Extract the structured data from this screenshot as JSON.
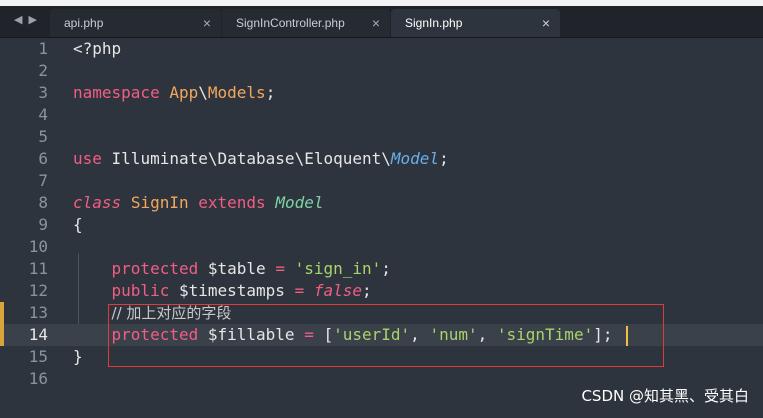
{
  "tabs": [
    {
      "label": "api.php",
      "close": "×",
      "active": false
    },
    {
      "label": "SignInController.php",
      "close": "×",
      "active": false
    },
    {
      "label": "SignIn.php",
      "close": "×",
      "active": true
    }
  ],
  "nav": {
    "prev": "◀",
    "next": "▶"
  },
  "lines": [
    {
      "n": "1",
      "tokens": [
        {
          "t": "<?php",
          "c": "plain"
        }
      ]
    },
    {
      "n": "2",
      "tokens": []
    },
    {
      "n": "3",
      "tokens": [
        {
          "t": "namespace",
          "c": "kw"
        },
        {
          "t": " ",
          "c": "plain"
        },
        {
          "t": "App",
          "c": "ns"
        },
        {
          "t": "\\",
          "c": "plain"
        },
        {
          "t": "Models",
          "c": "ns"
        },
        {
          "t": ";",
          "c": "plain"
        }
      ]
    },
    {
      "n": "4",
      "tokens": []
    },
    {
      "n": "5",
      "tokens": []
    },
    {
      "n": "6",
      "tokens": [
        {
          "t": "use",
          "c": "kw"
        },
        {
          "t": " Illuminate\\Database\\Eloquent\\",
          "c": "plain"
        },
        {
          "t": "Model",
          "c": "type"
        },
        {
          "t": ";",
          "c": "plain"
        }
      ]
    },
    {
      "n": "7",
      "tokens": []
    },
    {
      "n": "8",
      "tokens": [
        {
          "t": "class",
          "c": "kw ital"
        },
        {
          "t": " ",
          "c": "plain"
        },
        {
          "t": "SignIn",
          "c": "ns"
        },
        {
          "t": " ",
          "c": "plain"
        },
        {
          "t": "extends",
          "c": "kw"
        },
        {
          "t": " ",
          "c": "plain"
        },
        {
          "t": "Model",
          "c": "ext"
        }
      ]
    },
    {
      "n": "9",
      "tokens": [
        {
          "t": "{",
          "c": "plain"
        }
      ]
    },
    {
      "n": "10",
      "tokens": []
    },
    {
      "n": "11",
      "tokens": [
        {
          "t": "    ",
          "c": "plain"
        },
        {
          "t": "protected",
          "c": "kw"
        },
        {
          "t": " $",
          "c": "plain"
        },
        {
          "t": "table",
          "c": "var"
        },
        {
          "t": " ",
          "c": "plain"
        },
        {
          "t": "=",
          "c": "op"
        },
        {
          "t": " ",
          "c": "plain"
        },
        {
          "t": "'sign_in'",
          "c": "str"
        },
        {
          "t": ";",
          "c": "plain"
        }
      ]
    },
    {
      "n": "12",
      "tokens": [
        {
          "t": "    ",
          "c": "plain"
        },
        {
          "t": "public",
          "c": "kw"
        },
        {
          "t": " $",
          "c": "plain"
        },
        {
          "t": "timestamps",
          "c": "var"
        },
        {
          "t": " ",
          "c": "plain"
        },
        {
          "t": "=",
          "c": "op"
        },
        {
          "t": " ",
          "c": "plain"
        },
        {
          "t": "false",
          "c": "kw ital"
        },
        {
          "t": ";",
          "c": "plain"
        }
      ]
    },
    {
      "n": "13",
      "tokens": [
        {
          "t": "    ",
          "c": "plain"
        },
        {
          "t": "// 加上对应的字段",
          "c": "cmt"
        }
      ]
    },
    {
      "n": "14",
      "tokens": [
        {
          "t": "    ",
          "c": "plain"
        },
        {
          "t": "protected",
          "c": "kw"
        },
        {
          "t": " $",
          "c": "plain"
        },
        {
          "t": "fillable",
          "c": "var"
        },
        {
          "t": " ",
          "c": "plain"
        },
        {
          "t": "=",
          "c": "op"
        },
        {
          "t": " [",
          "c": "plain"
        },
        {
          "t": "'userId'",
          "c": "str"
        },
        {
          "t": ", ",
          "c": "plain"
        },
        {
          "t": "'num'",
          "c": "str"
        },
        {
          "t": ", ",
          "c": "plain"
        },
        {
          "t": "'signTime'",
          "c": "str"
        },
        {
          "t": "];",
          "c": "plain"
        }
      ]
    },
    {
      "n": "15",
      "tokens": [
        {
          "t": "}",
          "c": "plain"
        }
      ]
    },
    {
      "n": "16",
      "tokens": []
    }
  ],
  "active_line": "14",
  "modified_lines": [
    "13",
    "14"
  ],
  "watermark": "CSDN @知其黑、受其白",
  "colors": {
    "background": "#2e343d",
    "tabbar": "#20242a",
    "highlight_box": "#e03a3a"
  }
}
